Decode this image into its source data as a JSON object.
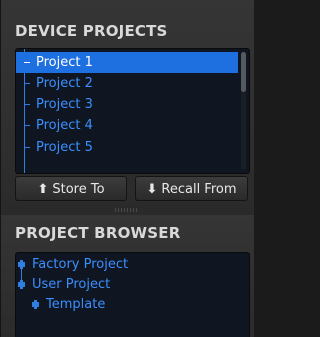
{
  "device_projects": {
    "title": "DEVICE PROJECTS",
    "items": [
      {
        "label": "Project 1",
        "selected": true
      },
      {
        "label": "Project 2",
        "selected": false
      },
      {
        "label": "Project 3",
        "selected": false
      },
      {
        "label": "Project 4",
        "selected": false
      },
      {
        "label": "Project 5",
        "selected": false
      }
    ],
    "store_label": "Store To",
    "recall_label": "Recall From"
  },
  "project_browser": {
    "title": "PROJECT BROWSER",
    "items": [
      {
        "label": "Factory Project"
      },
      {
        "label": "User Project"
      },
      {
        "label": "Template"
      }
    ]
  },
  "colors": {
    "accent": "#1e6fe0",
    "tree_text": "#3a8fff",
    "panel_bg": "#2a2a2a",
    "list_bg": "#0f1621"
  },
  "icons": {
    "store": "arrow-up-icon",
    "recall": "arrow-down-icon",
    "folder": "tree-node-icon"
  }
}
